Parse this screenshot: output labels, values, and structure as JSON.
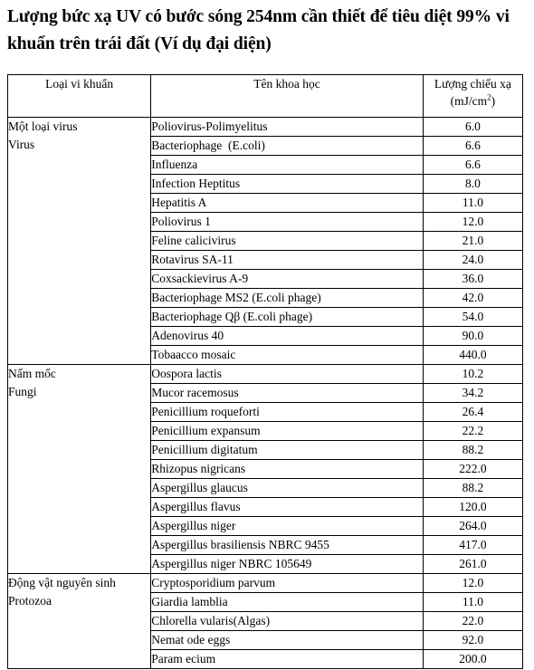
{
  "title": "Lượng bức xạ UV có bước sóng 254nm cần thiết để tiêu diệt 99% vi khuẩn trên trái đất (Ví dụ đại diện)",
  "table": {
    "headers": {
      "category": "Loại vi khuẩn",
      "scientific_name": "Tên khoa học",
      "dose_line1": "Lượng chiếu xạ",
      "dose_line2_prefix": "(mJ/cm",
      "dose_line2_sup": "2",
      "dose_line2_suffix": ")"
    },
    "sections": [
      {
        "category_line1": "Một loại virus",
        "category_line2": "Virus",
        "rows": [
          {
            "name": "Poliovirus-Polimyelitus",
            "dose": "6.0"
          },
          {
            "name": "Bacteriophage  (E.coli)",
            "dose": "6.6"
          },
          {
            "name": "Influenza",
            "dose": "6.6"
          },
          {
            "name": "Infection Heptitus",
            "dose": "8.0"
          },
          {
            "name": "Hepatitis A",
            "dose": "11.0"
          },
          {
            "name": "Poliovirus 1",
            "dose": "12.0"
          },
          {
            "name": "Feline calicivirus",
            "dose": "21.0"
          },
          {
            "name": "Rotavirus SA-11",
            "dose": "24.0"
          },
          {
            "name": "Coxsackievirus A-9",
            "dose": "36.0"
          },
          {
            "name": "Bacteriophage MS2 (E.coli phage)",
            "dose": "42.0"
          },
          {
            "name": "Bacteriophage Qβ (E.coli phage)",
            "dose": "54.0"
          },
          {
            "name": "Adenovirus 40",
            "dose": "90.0"
          },
          {
            "name": "Tobaacco mosaic",
            "dose": "440.0"
          }
        ]
      },
      {
        "category_line1": "Nấm mốc",
        "category_line2": "Fungi",
        "rows": [
          {
            "name": "Oospora lactis",
            "dose": "10.2"
          },
          {
            "name": "Mucor racemosus",
            "dose": "34.2"
          },
          {
            "name": "Penicillium roqueforti",
            "dose": "26.4"
          },
          {
            "name": "Penicillium expansum",
            "dose": "22.2"
          },
          {
            "name": "Penicillium digitatum",
            "dose": "88.2"
          },
          {
            "name": "Rhizopus nigricans",
            "dose": "222.0"
          },
          {
            "name": "Aspergillus glaucus",
            "dose": "88.2"
          },
          {
            "name": "Aspergillus flavus",
            "dose": "120.0"
          },
          {
            "name": "Aspergillus niger",
            "dose": "264.0"
          },
          {
            "name": "Aspergillus brasiliensis NBRC 9455",
            "dose": "417.0"
          },
          {
            "name": "Aspergillus niger NBRC 105649",
            "dose": "261.0"
          }
        ]
      },
      {
        "category_line1": "Động vật nguyên sinh",
        "category_line2": "Protozoa",
        "rows": [
          {
            "name": "Cryptosporidium parvum",
            "dose": "12.0"
          },
          {
            "name": "Giardia lamblia",
            "dose": "11.0"
          },
          {
            "name": "Chlorella vularis(Algas)",
            "dose": "22.0"
          },
          {
            "name": "Nemat ode eggs",
            "dose": "92.0"
          },
          {
            "name": "Param ecium",
            "dose": "200.0"
          }
        ]
      }
    ]
  }
}
